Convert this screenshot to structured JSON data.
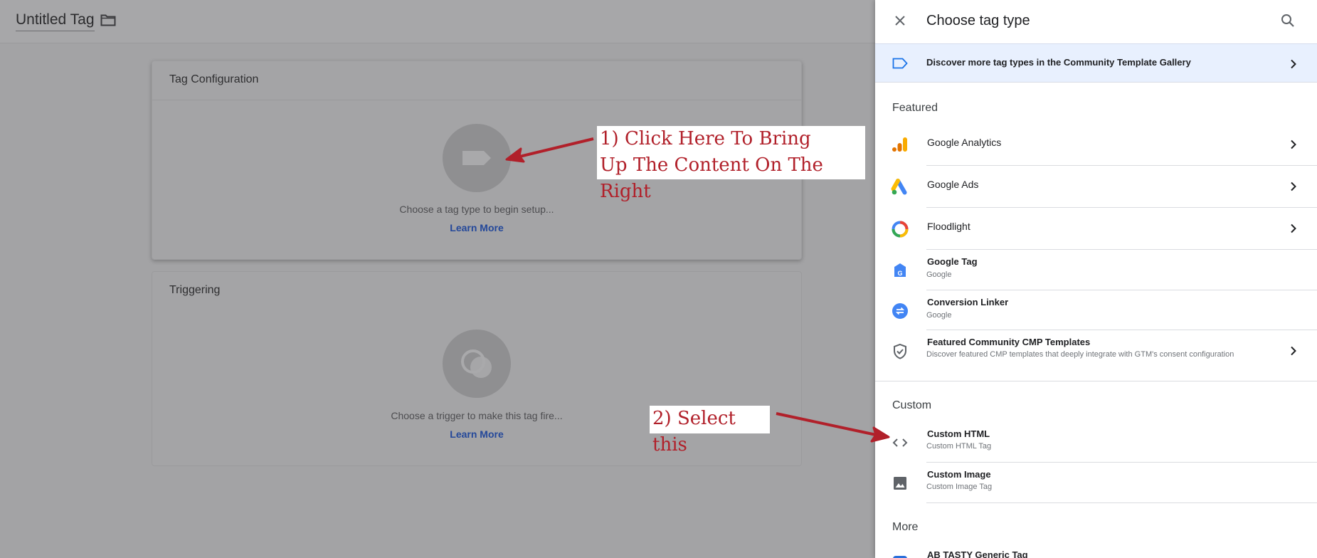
{
  "workspace": {
    "tag_title": "Untitled Tag",
    "tag_config": {
      "heading": "Tag Configuration",
      "hint": "Choose a tag type to begin setup...",
      "learn_more": "Learn More"
    },
    "triggering": {
      "heading": "Triggering",
      "hint": "Choose a trigger to make this tag fire...",
      "learn_more": "Learn More"
    }
  },
  "annotations": {
    "note1_line1": "1) Click Here To Bring",
    "note1_line2": "Up The Content On The Right",
    "note2": "2) Select this"
  },
  "panel": {
    "title": "Choose tag type",
    "gallery_banner": "Discover more tag types in the Community Template Gallery",
    "sections": {
      "featured": "Featured",
      "custom": "Custom",
      "more": "More"
    },
    "featured_items": [
      {
        "name": "Google Analytics",
        "icon": "google-analytics-icon"
      },
      {
        "name": "Google Ads",
        "icon": "google-ads-icon"
      },
      {
        "name": "Floodlight",
        "icon": "floodlight-icon"
      },
      {
        "name": "Google Tag",
        "sub": "Google",
        "icon": "google-tag-icon"
      },
      {
        "name": "Conversion Linker",
        "sub": "Google",
        "icon": "conversion-linker-icon"
      },
      {
        "name": "Featured Community CMP Templates",
        "sub": "Discover featured CMP templates that deeply integrate with GTM's consent configuration",
        "icon": "shield-check-icon"
      }
    ],
    "custom_items": [
      {
        "name": "Custom HTML",
        "sub": "Custom HTML Tag",
        "icon": "code-icon"
      },
      {
        "name": "Custom Image",
        "sub": "Custom Image Tag",
        "icon": "image-icon"
      }
    ],
    "more_items": [
      {
        "name": "AB TASTY Generic Tag",
        "icon": "ab-tasty-icon"
      }
    ]
  },
  "colors": {
    "annotation_red": "#b1202a",
    "gallery_bg": "#e8f0fe",
    "link_blue": "#24489a"
  }
}
